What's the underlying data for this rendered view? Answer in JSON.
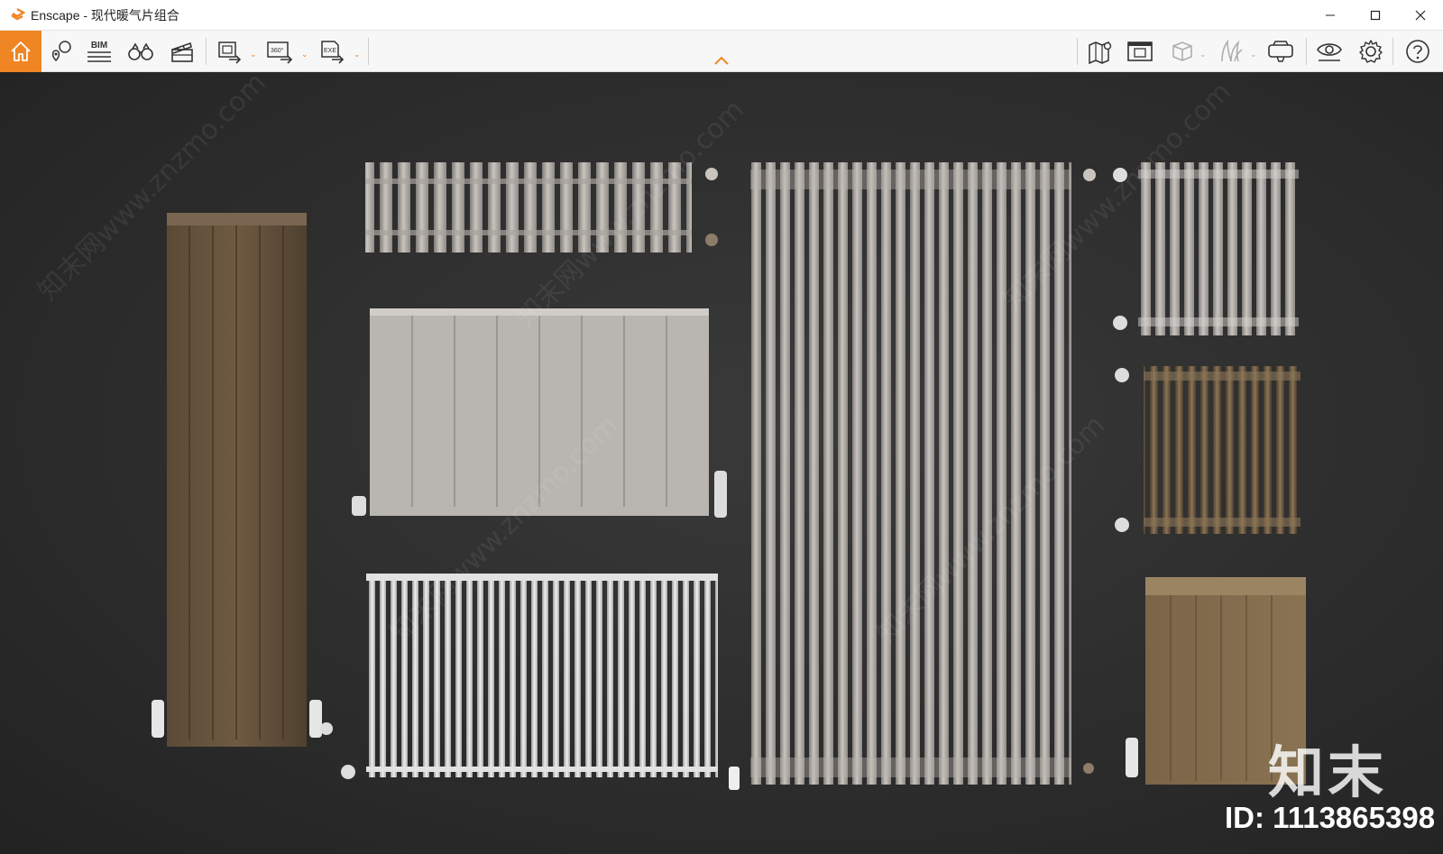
{
  "window": {
    "app_name": "Enscape",
    "title": "Enscape - 现代暖气片组合",
    "controls": {
      "minimize": "—",
      "maximize": "☐",
      "close": "✕"
    }
  },
  "toolbar": {
    "bim_label": "BIM",
    "pano_label": "360°",
    "exe_label": "EXE",
    "accent_color": "#f08523",
    "left_tools": [
      "home-icon",
      "asset-library-icon",
      "bim-icon",
      "views-icon",
      "video-editor-icon",
      "render-export-icon",
      "panorama-export-icon",
      "exe-export-icon"
    ],
    "right_tools": [
      "map-icon",
      "visual-settings-screen-icon",
      "view-box-icon",
      "grass-icon",
      "vr-headset-icon",
      "eye-icon",
      "gear-icon",
      "help-icon"
    ]
  },
  "viewport": {
    "watermark_brand": "知末",
    "watermark_id": "ID: 1113865398",
    "watermark_text": "知末网www.znzmo.com"
  }
}
